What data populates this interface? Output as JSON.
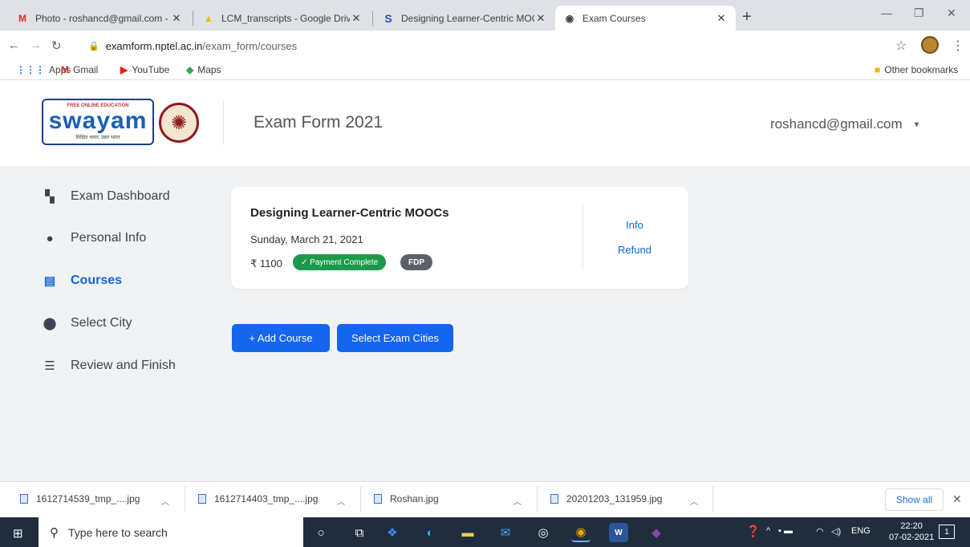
{
  "browser": {
    "tabs": [
      {
        "title": "Photo - roshancd@gmail.com - G",
        "icon": "gmail-icon",
        "active": false
      },
      {
        "title": "LCM_transcripts - Google Drive",
        "icon": "google-drive-icon",
        "active": false
      },
      {
        "title": "Designing Learner-Centric MOOCs",
        "icon": "swayam-s-icon",
        "active": false
      },
      {
        "title": "Exam Courses",
        "icon": "globe-icon",
        "active": true
      }
    ],
    "url_domain": "examform.nptel.ac.in",
    "url_path": "/exam_form/courses",
    "bookmarks": [
      "Apps",
      "Gmail",
      "YouTube",
      "Maps"
    ],
    "other_bookmarks": "Other bookmarks"
  },
  "header": {
    "logo_tagline": "FREE ONLINE EDUCATION",
    "logo_word": "swayam",
    "logo_subtitle": "शिक्षित भारत, उन्नत भारत",
    "title": "Exam Form 2021",
    "user_email": "roshancd@gmail.com"
  },
  "sidebar": {
    "items": [
      {
        "label": "Exam Dashboard",
        "icon": "dashboard-icon",
        "active": false
      },
      {
        "label": "Personal Info",
        "icon": "user-circle-icon",
        "active": false
      },
      {
        "label": "Courses",
        "icon": "clipboard-icon",
        "active": true
      },
      {
        "label": "Select City",
        "icon": "location-pin-icon",
        "active": false
      },
      {
        "label": "Review and Finish",
        "icon": "list-icon",
        "active": false
      }
    ]
  },
  "course_card": {
    "name": "Designing Learner-Centric MOOCs",
    "date": "Sunday, March 21, 2021",
    "fee": "₹ 1100",
    "payment_status": "✓ Payment Complete",
    "category": "FDP",
    "info_link": "Info",
    "refund_link": "Refund"
  },
  "actions": {
    "add_course": "+ Add Course",
    "select_cities": "Select Exam Cities"
  },
  "downloads": {
    "items": [
      "1612714539_tmp_....jpg",
      "1612714403_tmp_....jpg",
      "Roshan.jpg",
      "20201203_131959.jpg"
    ],
    "show_all": "Show all"
  },
  "taskbar": {
    "search_placeholder": "Type here to search",
    "language": "ENG",
    "time": "22:20",
    "date": "07-02-2021",
    "notification_count": "1"
  },
  "colors": {
    "accent": "#1565ee",
    "payment_badge": "#1b9a4a",
    "fdp_badge": "#5a5f6a",
    "main_bg": "#f0f2f4"
  }
}
